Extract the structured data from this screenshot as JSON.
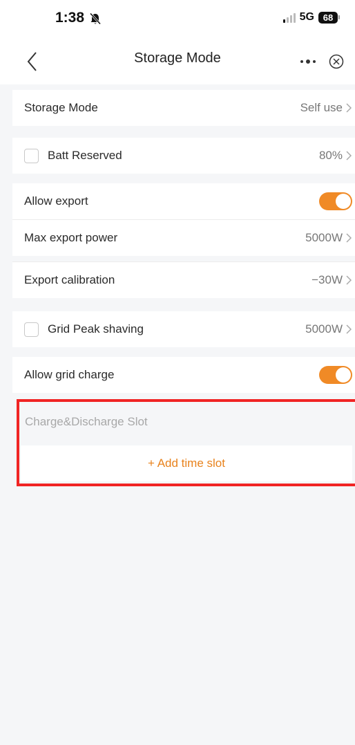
{
  "status_bar": {
    "time": "1:38",
    "network": "5G",
    "battery": "68"
  },
  "nav": {
    "title": "Storage Mode"
  },
  "settings": {
    "storage_mode": {
      "label": "Storage Mode",
      "value": "Self use"
    },
    "batt_reserved": {
      "label": "Batt Reserved",
      "value": "80%",
      "checked": false
    },
    "allow_export": {
      "label": "Allow export",
      "enabled": true
    },
    "max_export_power": {
      "label": "Max export power",
      "value": "5000W"
    },
    "export_calibration": {
      "label": "Export calibration",
      "value": "−30W"
    },
    "grid_peak_shaving": {
      "label": "Grid Peak shaving",
      "value": "5000W",
      "checked": false
    },
    "allow_grid_charge": {
      "label": "Allow grid charge",
      "enabled": true
    }
  },
  "slots": {
    "header": "Charge&Discharge Slot",
    "add_label": "+ Add time slot"
  },
  "colors": {
    "accent": "#f08a26",
    "highlight": "#f02424",
    "background": "#f5f6f8"
  }
}
